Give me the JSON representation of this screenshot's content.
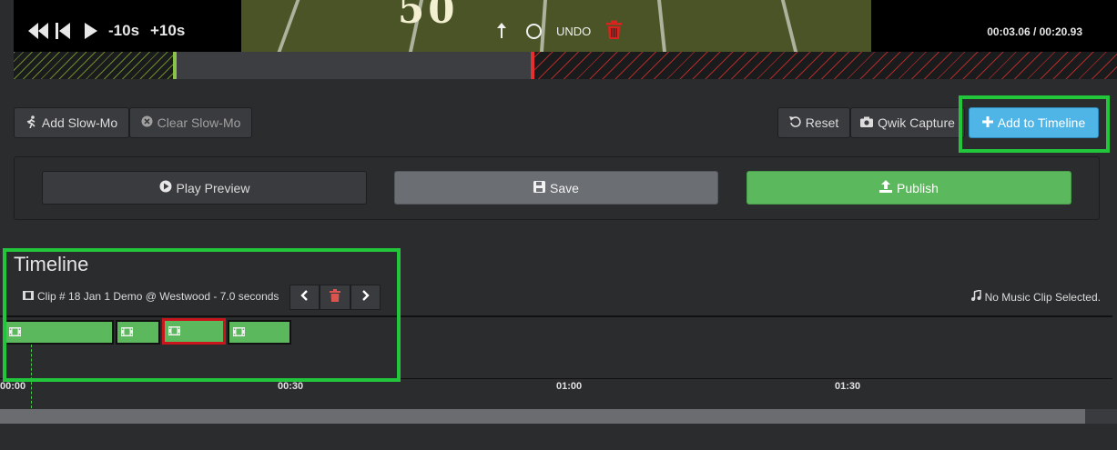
{
  "player": {
    "skip_back_label": "-10s",
    "skip_fwd_label": "+10s",
    "undo_label": "UNDO",
    "yard_number": "50",
    "time_readout": "00:03.06 / 00:20.93"
  },
  "edit_toolbar": {
    "add_slowmo": "Add Slow-Mo",
    "clear_slowmo": "Clear Slow-Mo",
    "reset": "Reset",
    "qwik_capture": "Qwik Capture",
    "add_to_timeline": "Add to Timeline"
  },
  "actions": {
    "play_preview": "Play Preview",
    "save": "Save",
    "publish": "Publish"
  },
  "timeline": {
    "title": "Timeline",
    "clip_info": "Clip # 18 Jan 1 Demo @ Westwood - 7.0 seconds",
    "music_status": "No Music Clip Selected.",
    "ticks": [
      "00:00",
      "00:30",
      "01:00",
      "01:30"
    ]
  },
  "colors": {
    "accent_blue": "#4fb5e6",
    "publish_green": "#5cb85c",
    "highlight_green": "#22c63a",
    "selected_red": "#c8161c"
  }
}
